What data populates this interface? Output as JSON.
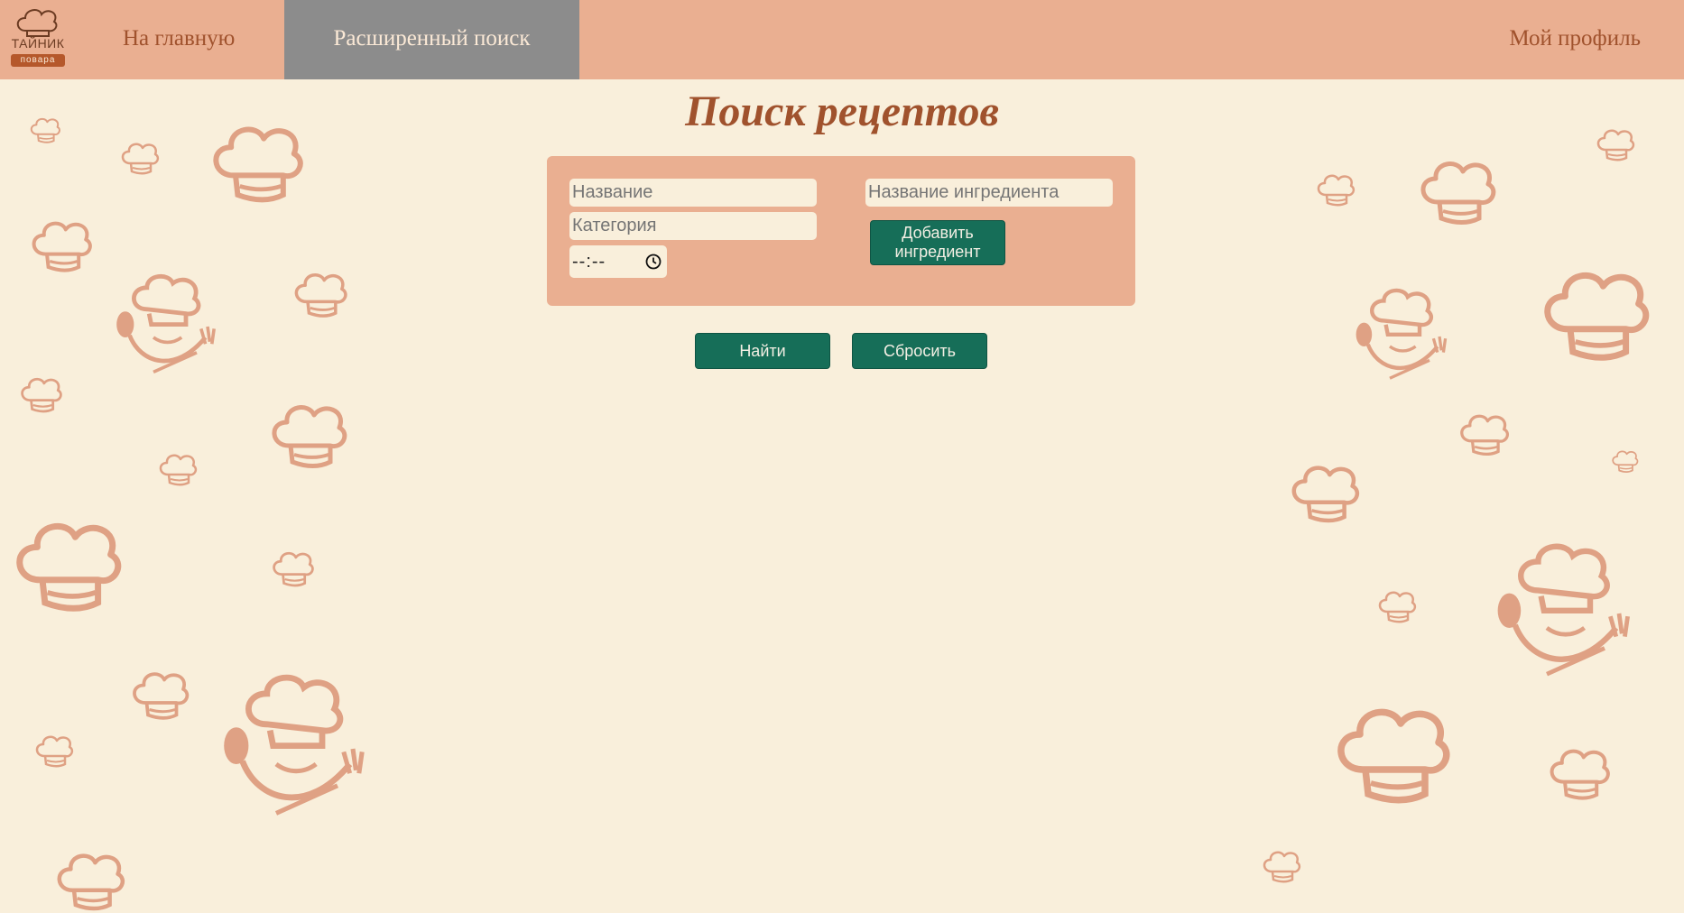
{
  "logo": {
    "line1": "ТАЙНИК",
    "line2": "повара"
  },
  "nav": {
    "home": "На главную",
    "advanced_search": "Расширенный поиск",
    "profile": "Мой профиль"
  },
  "page": {
    "title": "Поиск рецептов"
  },
  "form": {
    "name_placeholder": "Название",
    "category_placeholder": "Категория",
    "ingredient_placeholder": "Название ингредиента",
    "time_value": "--:--",
    "add_ingredient_label": "Добавить ингредиент"
  },
  "actions": {
    "find": "Найти",
    "reset": "Сбросить"
  },
  "colors": {
    "background": "#f9efdb",
    "nav_bar": "#eaaf91",
    "nav_active": "#8c8c8c",
    "accent_text": "#a0522d",
    "button": "#166e58"
  },
  "icons": {
    "logo": "chef-hat-icon",
    "time": "clock-icon",
    "decoration": "chef-hat-icon"
  }
}
